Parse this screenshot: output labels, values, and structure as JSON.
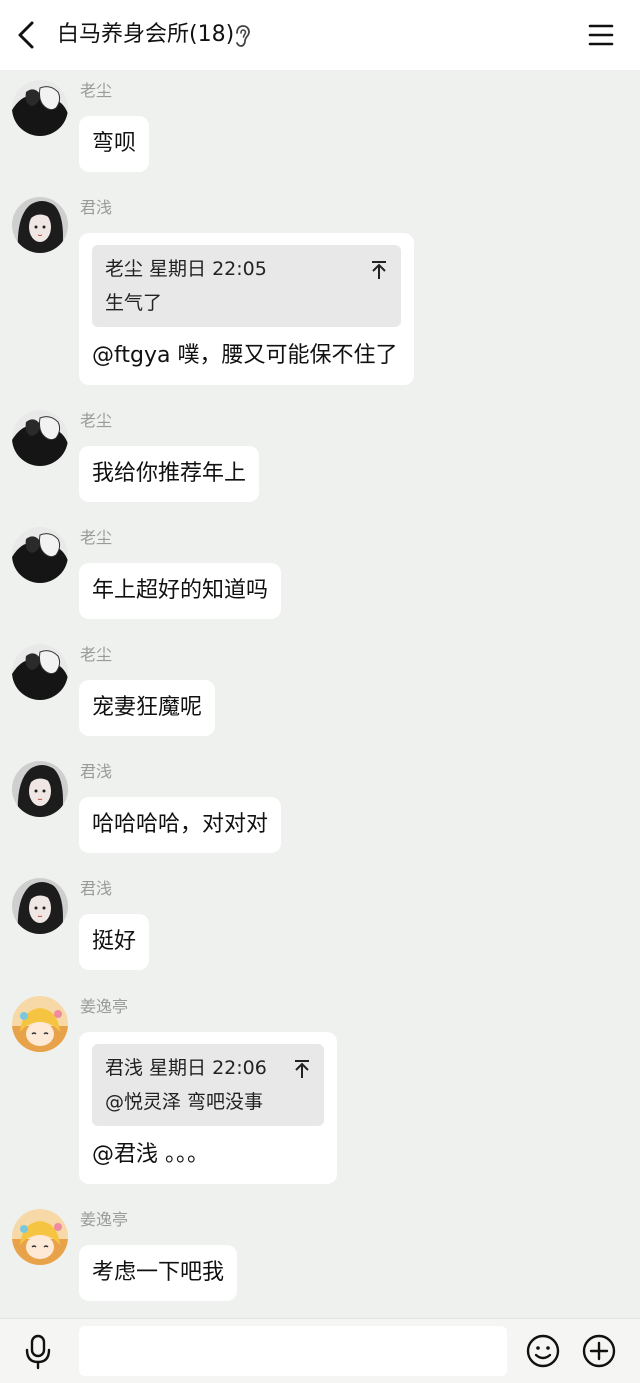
{
  "header": {
    "title": "白马养身会所(18)"
  },
  "messages": [
    {
      "sender": "老尘",
      "avatar": "avatar-laochen",
      "text": "弯呗"
    },
    {
      "sender": "君浅",
      "avatar": "avatar-junqian",
      "quote": {
        "header": "老尘 星期日 22:05",
        "text": "生气了"
      },
      "text": "@ftgya 噗，腰又可能保不住了"
    },
    {
      "sender": "老尘",
      "avatar": "avatar-laochen",
      "text": "我给你推荐年上"
    },
    {
      "sender": "老尘",
      "avatar": "avatar-laochen",
      "text": "年上超好的知道吗"
    },
    {
      "sender": "老尘",
      "avatar": "avatar-laochen",
      "text": "宠妻狂魔呢"
    },
    {
      "sender": "君浅",
      "avatar": "avatar-junqian",
      "text": "哈哈哈哈，对对对"
    },
    {
      "sender": "君浅",
      "avatar": "avatar-junqian",
      "text": "挺好"
    },
    {
      "sender": "姜逸亭",
      "avatar": "avatar-jiangyiting",
      "quote": {
        "header": "君浅 星期日 22:06",
        "text": "@悦灵泽 弯吧没事"
      },
      "text": "@君浅 。。。"
    },
    {
      "sender": "姜逸亭",
      "avatar": "avatar-jiangyiting",
      "text": "考虑一下吧我"
    }
  ],
  "input": {
    "value": "",
    "placeholder": ""
  },
  "icons": [
    "back-icon",
    "ear-icon",
    "menu-icon",
    "pin-icon",
    "mic-icon",
    "emoji-icon",
    "plus-icon"
  ],
  "colors": {
    "background": "#eff1ee",
    "bubble": "#ffffff",
    "quote": "#e8e8e8",
    "name": "#9a9a9a"
  }
}
